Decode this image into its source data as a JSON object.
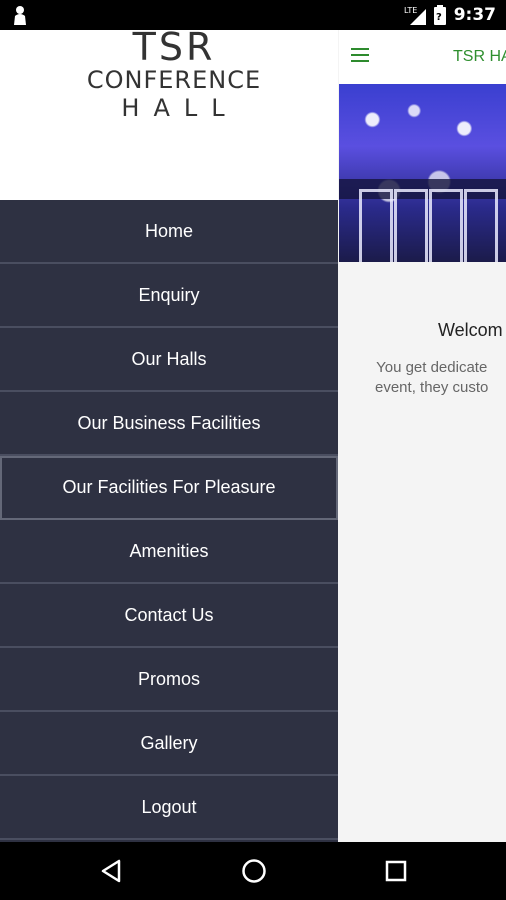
{
  "status_bar": {
    "time": "9:37",
    "icons": [
      "person-icon",
      "lte-signal-icon",
      "battery-icon"
    ]
  },
  "app": {
    "title": "TSR HA",
    "welcome": "Welcom",
    "description_line1": "You get dedicate",
    "description_line2": "event, they custo"
  },
  "drawer": {
    "logo": {
      "line1": "TSR",
      "line2": "CONFERENCE",
      "line3": "HALL"
    },
    "items": [
      {
        "label": "Home"
      },
      {
        "label": "Enquiry"
      },
      {
        "label": "Our Halls"
      },
      {
        "label": "Our Business Facilities"
      },
      {
        "label": "Our Facilities For Pleasure"
      },
      {
        "label": "Amenities"
      },
      {
        "label": "Contact Us"
      },
      {
        "label": "Promos"
      },
      {
        "label": "Gallery"
      },
      {
        "label": "Logout"
      }
    ],
    "active_index": 4
  },
  "colors": {
    "drawer_bg": "#2e3142",
    "accent_green": "#2f8f2f",
    "divider": "#4a4e60"
  },
  "nav_bar": {
    "buttons": [
      "back-icon",
      "home-icon",
      "recents-icon"
    ]
  }
}
